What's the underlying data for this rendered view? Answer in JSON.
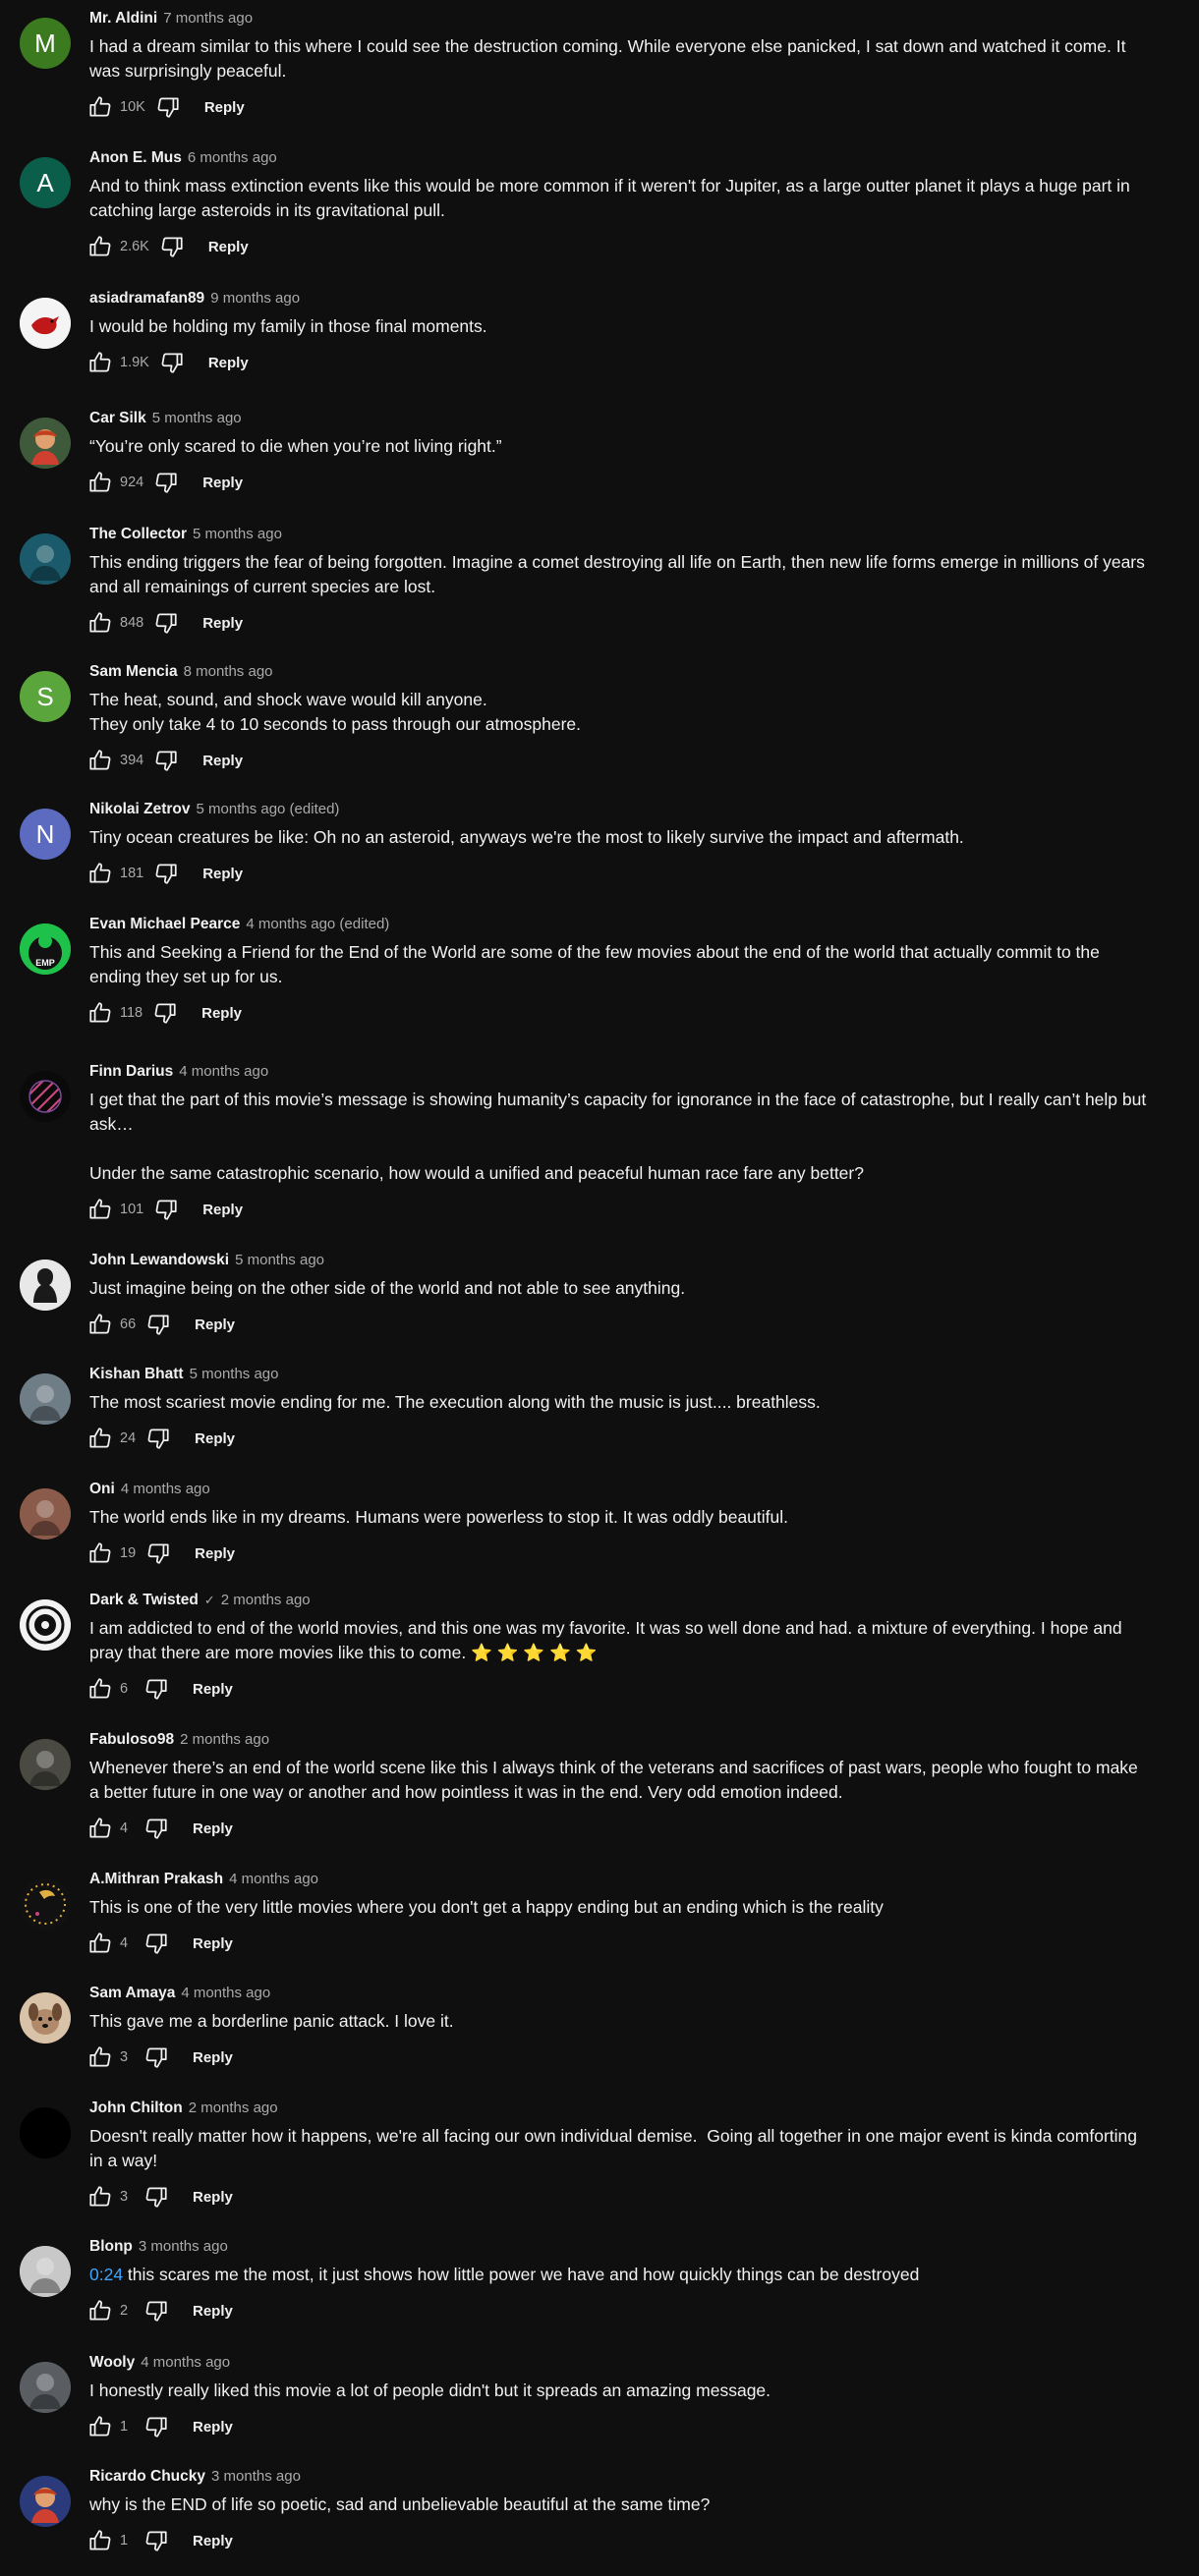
{
  "actions": {
    "reply_label": "Reply"
  },
  "colors": {
    "background": "#0f0f0f",
    "text_primary": "#f1f1f1",
    "text_secondary": "#aaaaaa",
    "timestamp_link": "#3ea6ff"
  },
  "comments": [
    {
      "author": "Mr. Aldini",
      "time": "7 months ago",
      "text": "I had a dream similar to this where I could see the destruction coming. While everyone else panicked, I sat down and watched it come. It was surprisingly peaceful.",
      "likes": "10K",
      "avatar": {
        "letter": "M",
        "color": "#3b7a1f",
        "icon": "letter-avatar"
      }
    },
    {
      "author": "Anon E. Mus",
      "time": "6 months ago",
      "text": "And to think mass extinction events like this would be more common if it weren't for Jupiter, as a large outter planet it plays a huge part in catching large asteroids in its gravitational pull.",
      "likes": "2.6K",
      "avatar": {
        "letter": "A",
        "color": "#0b5e4a",
        "icon": "letter-avatar"
      }
    },
    {
      "author": "asiadramafan89",
      "time": "9 months ago",
      "text": "I would be holding my family in those final moments.",
      "likes": "1.9K",
      "avatar": {
        "letter": "",
        "color": "#f4f4f4",
        "icon": "red-bird-avatar"
      }
    },
    {
      "author": "Car Silk",
      "time": "5 months ago",
      "text": "“You’re only scared to die when you’re not living right.”",
      "likes": "924",
      "avatar": {
        "letter": "",
        "color": "#3e5a3a",
        "icon": "cartoon-avatar"
      }
    },
    {
      "author": "The Collector",
      "time": "5 months ago",
      "text": "This ending triggers the fear of being forgotten. Imagine a comet destroying all life on Earth, then new life forms emerge in millions of years and all remainings of current species are lost.",
      "likes": "848",
      "avatar": {
        "letter": "",
        "color": "#1a5a6a",
        "icon": "photo-avatar"
      }
    },
    {
      "author": "Sam Mencia",
      "time": "8 months ago",
      "text": "The heat, sound, and shock wave would kill anyone.\nThey only take 4 to 10 seconds to pass through our atmosphere.",
      "likes": "394",
      "avatar": {
        "letter": "S",
        "color": "#5aa63c",
        "icon": "letter-avatar"
      }
    },
    {
      "author": "Nikolai Zetrov",
      "time": "5 months ago (edited)",
      "text": "Tiny ocean creatures be like: Oh no an asteroid, anyways we're the most to likely survive the impact and aftermath.",
      "likes": "181",
      "avatar": {
        "letter": "N",
        "color": "#5c6bc0",
        "icon": "letter-avatar"
      }
    },
    {
      "author": "Evan Michael Pearce",
      "time": "4 months ago (edited)",
      "text": "This and Seeking a Friend for the End of the World are some of the few movies about the end of the world that actually commit to the ending they set up for us.",
      "likes": "118",
      "avatar": {
        "letter": "EMP",
        "color": "#1ec24a",
        "icon": "emp-logo-avatar"
      }
    },
    {
      "author": "Finn Darius",
      "time": "4 months ago",
      "text": "I get that the part of this movie’s message is showing humanity’s capacity for ignorance in the face of catastrophe, but I really can’t help but ask…\n\nUnder the same catastrophic scenario, how would a unified and peaceful human race fare any better?",
      "likes": "101",
      "avatar": {
        "letter": "",
        "color": "#0a0a0a",
        "icon": "striped-circle-avatar"
      }
    },
    {
      "author": "John Lewandowski",
      "time": "5 months ago",
      "text": "Just imagine being on the other side of the world and not able to see anything.",
      "likes": "66",
      "avatar": {
        "letter": "",
        "color": "#e8e8e8",
        "icon": "silhouette-avatar"
      }
    },
    {
      "author": "Kishan Bhatt",
      "time": "5 months ago",
      "text": "The most scariest movie ending for me. The execution along with the music is just.... breathless.",
      "likes": "24",
      "avatar": {
        "letter": "",
        "color": "#6f7d86",
        "icon": "photo-avatar"
      }
    },
    {
      "author": "Oni",
      "time": "4 months ago",
      "text": "The world ends like in my dreams. Humans were powerless to stop it. It was oddly beautiful.",
      "likes": "19",
      "avatar": {
        "letter": "",
        "color": "#8a5a4a",
        "icon": "photo-avatar"
      }
    },
    {
      "author": "Dark & Twisted",
      "time": "2 months ago",
      "verified": "✓",
      "text": "I am addicted to end of the world movies, and this one was my favorite. It was so well done and had. a mixture of everything. I hope and pray that there are more movies like this to come. ⭐ ⭐ ⭐ ⭐ ⭐",
      "likes": "6",
      "avatar": {
        "letter": "",
        "color": "#f2f2f2",
        "icon": "badge-logo-avatar"
      }
    },
    {
      "author": "Fabuloso98",
      "time": "2 months ago",
      "text": "Whenever there’s an end of the world scene like this I always think of the veterans and sacrifices of past wars, people who fought to make a better future in one way or another and how pointless it was in the end. Very odd emotion indeed.",
      "likes": "4",
      "avatar": {
        "letter": "",
        "color": "#4a4a42",
        "icon": "photo-avatar"
      }
    },
    {
      "author": "A.Mithran Prakash",
      "time": "4 months ago",
      "text": "This is one of the very little movies where you don't get a happy ending but an ending which is the reality",
      "likes": "4",
      "avatar": {
        "letter": "",
        "color": "#1a1a1a",
        "icon": "golden-ring-avatar"
      }
    },
    {
      "author": "Sam Amaya",
      "time": "4 months ago",
      "text": "This gave me a borderline panic attack. I love it.",
      "likes": "3",
      "avatar": {
        "letter": "",
        "color": "#b08a6a",
        "icon": "dog-avatar"
      }
    },
    {
      "author": "John Chilton",
      "time": "2 months ago",
      "text": "Doesn't really matter how it happens, we're all facing our own individual demise.  Going all together in one major event is kinda comforting in a way!",
      "likes": "3",
      "avatar": {
        "letter": "",
        "color": "#000000",
        "icon": "black-avatar"
      }
    },
    {
      "author": "Blonp",
      "time": "3 months ago",
      "timestamp_link": "0:24",
      "text": " this scares me the most, it just shows how little power we have and how quickly things can be destroyed",
      "likes": "2",
      "avatar": {
        "letter": "",
        "color": "#c8c8c8",
        "icon": "photo-avatar"
      }
    },
    {
      "author": "Wooly",
      "time": "4 months ago",
      "text": "I honestly really liked this movie a lot of people didn't but it spreads an amazing message.",
      "likes": "1",
      "avatar": {
        "letter": "",
        "color": "#5a5e62",
        "icon": "photo-avatar"
      }
    },
    {
      "author": "Ricardo Chucky",
      "time": "3 months ago",
      "text": "why is the END of life so poetic, sad and unbelievable beautiful at the same time?",
      "likes": "1",
      "avatar": {
        "letter": "",
        "color": "#2a3a7a",
        "icon": "cartoon-avatar"
      }
    }
  ]
}
